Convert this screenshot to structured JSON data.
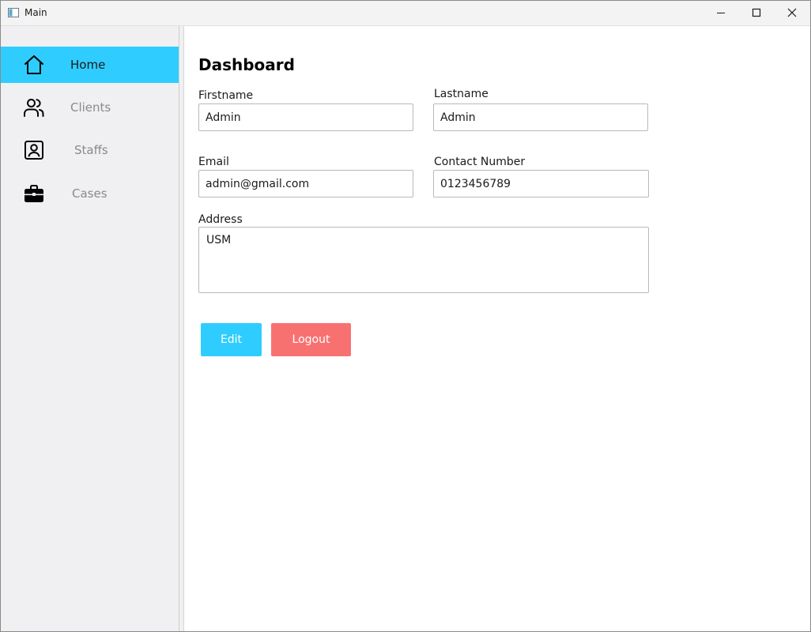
{
  "window": {
    "title": "Main"
  },
  "sidebar": {
    "items": [
      {
        "label": "Home",
        "icon": "home-icon",
        "active": true
      },
      {
        "label": "Clients",
        "icon": "users-icon",
        "active": false
      },
      {
        "label": "Staffs",
        "icon": "contact-card-icon",
        "active": false
      },
      {
        "label": "Cases",
        "icon": "briefcase-icon",
        "active": false
      }
    ]
  },
  "main": {
    "title": "Dashboard",
    "fields": {
      "firstname": {
        "label": "Firstname",
        "value": "Admin"
      },
      "lastname": {
        "label": "Lastname",
        "value": "Admin"
      },
      "email": {
        "label": "Email",
        "value": "admin@gmail.com"
      },
      "contact": {
        "label": "Contact Number",
        "value": "0123456789"
      },
      "address": {
        "label": "Address",
        "value": "USM"
      }
    },
    "buttons": {
      "edit": "Edit",
      "logout": "Logout"
    }
  },
  "colors": {
    "accent": "#2fcdff",
    "logout": "#f87171",
    "sidebar_bg": "#f0f0f2"
  }
}
